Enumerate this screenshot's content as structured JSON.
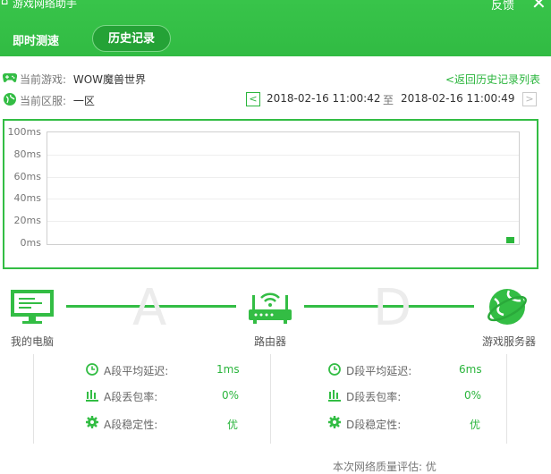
{
  "window": {
    "title": "游戏网络助手",
    "feedback": "反馈",
    "close": "✕"
  },
  "tabs": [
    {
      "label": "即时测速"
    },
    {
      "label": "历史记录"
    }
  ],
  "info": {
    "game_label": "当前游戏:",
    "game_value": "WOW魔兽世界",
    "region_label": "当前区服:",
    "region_value": "一区",
    "back_link": "<返回历史记录列表",
    "prev": "<",
    "next": ">",
    "start_time": "2018-02-16 11:00:42",
    "to": "至",
    "end_time": "2018-02-16 11:00:49"
  },
  "chart_data": {
    "type": "scatter",
    "y_ticks": [
      "100ms",
      "80ms",
      "60ms",
      "40ms",
      "20ms",
      "0ms"
    ],
    "ylim": [
      0,
      100
    ],
    "grid": true,
    "series": [
      {
        "values": [
          1
        ]
      }
    ]
  },
  "diagram": {
    "pc_label": "我的电脑",
    "router_label": "路由器",
    "server_label": "游戏服务器",
    "seg_a": "A",
    "seg_d": "D"
  },
  "stats": {
    "a_latency_label": "A段平均延迟:",
    "a_latency": "1ms",
    "a_loss_label": "A段丢包率:",
    "a_loss": "0%",
    "a_stability_label": "A段稳定性:",
    "a_stability": "优",
    "d_latency_label": "D段平均延迟:",
    "d_latency": "6ms",
    "d_loss_label": "D段丢包率:",
    "d_loss": "0%",
    "d_stability_label": "D段稳定性:",
    "d_stability": "优"
  },
  "footer_partial": "本次网络质量评估:   优",
  "colors": {
    "accent": "#33bd44",
    "accent_dark": "#24a236"
  }
}
